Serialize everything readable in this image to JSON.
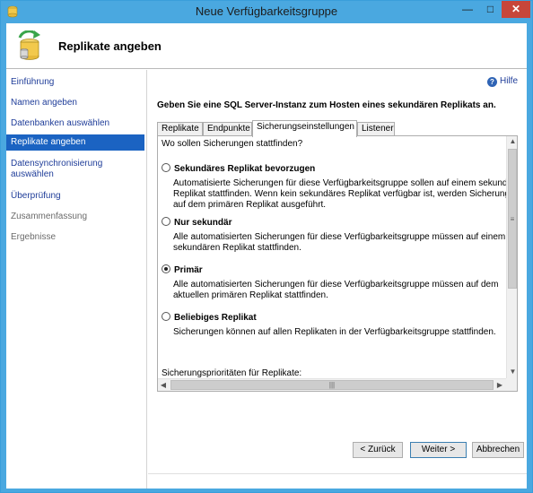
{
  "window": {
    "title": "Neue Verfügbarkeitsgruppe",
    "minimize_label": "—",
    "maximize_label": "□",
    "close_label": "✕"
  },
  "header": {
    "title": "Replikate angeben"
  },
  "sidebar": {
    "items": [
      {
        "label": "Einführung",
        "state": "link"
      },
      {
        "label": "Namen angeben",
        "state": "link"
      },
      {
        "label": "Datenbanken auswählen",
        "state": "link"
      },
      {
        "label": "Replikate angeben",
        "state": "active"
      },
      {
        "label": "Datensynchronisierung auswählen",
        "state": "link"
      },
      {
        "label": "Überprüfung",
        "state": "link"
      },
      {
        "label": "Zusammenfassung",
        "state": "disabled"
      },
      {
        "label": "Ergebnisse",
        "state": "disabled"
      }
    ]
  },
  "main": {
    "help_label": "Hilfe",
    "instruction": "Geben Sie eine SQL Server-Instanz zum Hosten eines sekundären Replikats an.",
    "tabs": [
      {
        "label": "Replikate"
      },
      {
        "label": "Endpunkte"
      },
      {
        "label": "Sicherungseinstellungen",
        "active": true
      },
      {
        "label": "Listener"
      }
    ],
    "backup": {
      "question": "Wo sollen Sicherungen stattfinden?",
      "options": [
        {
          "label": "Sekundäres Replikat bevorzugen",
          "checked": false,
          "lines": [
            "Automatisierte Sicherungen für diese Verfügbarkeitsgruppe sollen auf einem sekundäre",
            "Replikat stattfinden. Wenn kein sekundäres Replikat verfügbar ist, werden Sicherungen",
            "auf dem primären Replikat ausgeführt."
          ]
        },
        {
          "label": "Nur sekundär",
          "checked": false,
          "lines": [
            "Alle automatisierten Sicherungen für diese Verfügbarkeitsgruppe müssen auf einem",
            "sekundären Replikat stattfinden."
          ]
        },
        {
          "label": "Primär",
          "checked": true,
          "lines": [
            "Alle automatisierten Sicherungen für diese Verfügbarkeitsgruppe müssen auf dem",
            "aktuellen primären Replikat stattfinden."
          ]
        },
        {
          "label": "Beliebiges Replikat",
          "checked": false,
          "lines": [
            "Sicherungen können auf allen Replikaten in der Verfügbarkeitsgruppe stattfinden."
          ]
        }
      ],
      "priorities_label": "Sicherungsprioritäten für Replikate:"
    }
  },
  "footer": {
    "back_label": "< Zurück",
    "next_label": "Weiter >",
    "cancel_label": "Abbrechen"
  },
  "colors": {
    "titlebar": "#4aa8e0",
    "active_nav": "#1b63c2",
    "link": "#1f3d99",
    "close_button": "#c7463a"
  }
}
